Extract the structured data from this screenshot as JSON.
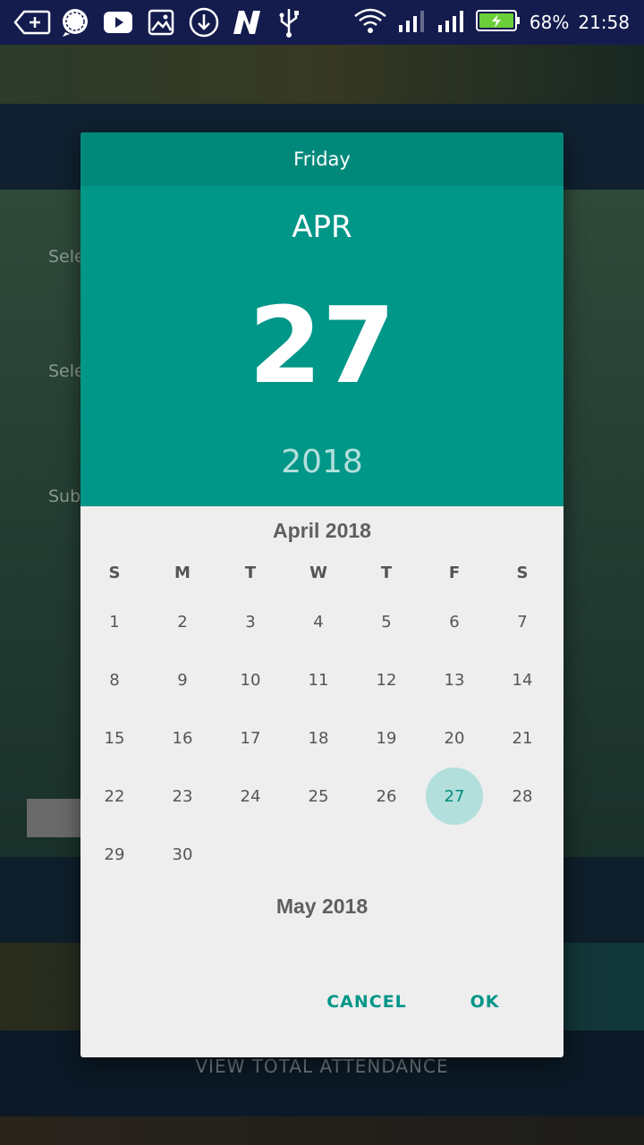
{
  "status_bar": {
    "battery": "68%",
    "time": "21:58",
    "icons": [
      "add-icon",
      "chat-bubble-icon",
      "youtube-icon",
      "gallery-icon",
      "download-icon",
      "n-app-icon",
      "usb-icon",
      "wifi-icon",
      "signal-icon",
      "signal-icon",
      "battery-charging-icon"
    ]
  },
  "background": {
    "labels": [
      "Sele",
      "Sele",
      "Sub"
    ],
    "footer": "VIEW TOTAL ATTENDANCE"
  },
  "dialog": {
    "weekday": "Friday",
    "month": "APR",
    "day": "27",
    "year": "2018",
    "current_month_title": "April 2018",
    "next_month_title": "May 2018",
    "weekdays": [
      "S",
      "M",
      "T",
      "W",
      "T",
      "F",
      "S"
    ],
    "days": [
      [
        "1",
        "2",
        "3",
        "4",
        "5",
        "6",
        "7"
      ],
      [
        "8",
        "9",
        "10",
        "11",
        "12",
        "13",
        "14"
      ],
      [
        "15",
        "16",
        "17",
        "18",
        "19",
        "20",
        "21"
      ],
      [
        "22",
        "23",
        "24",
        "25",
        "26",
        "27",
        "28"
      ],
      [
        "29",
        "30",
        "",
        "",
        "",
        "",
        ""
      ]
    ],
    "selected_day": "27",
    "cancel_label": "CANCEL",
    "ok_label": "OK"
  },
  "colors": {
    "accent": "#009688",
    "header_dark": "#00897b",
    "selected_circle": "#b2dfdb",
    "dialog_bg": "#eeeeee"
  }
}
